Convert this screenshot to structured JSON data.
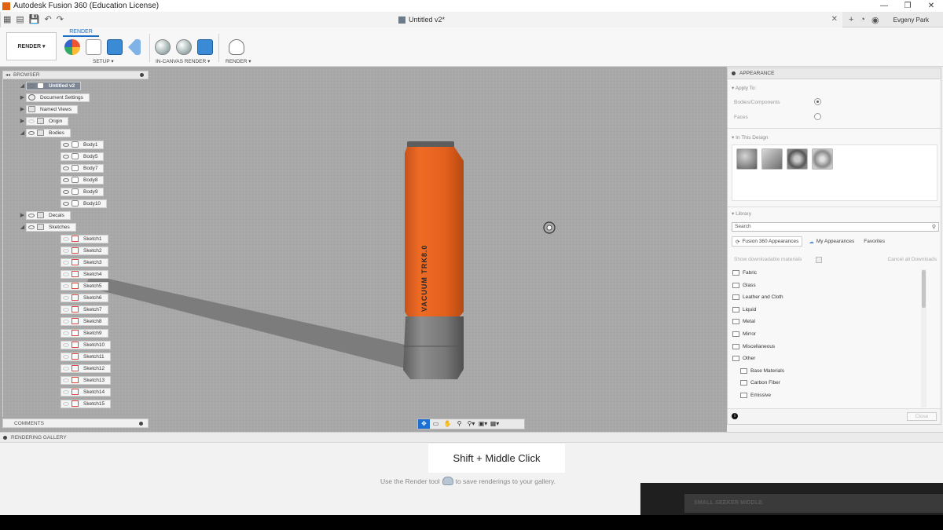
{
  "window": {
    "title": "Autodesk Fusion 360 (Education License)",
    "minimize": "—",
    "restore": "❐",
    "close": "✕"
  },
  "tabs": {
    "document_title": "Untitled v2*",
    "tab_close": "✕",
    "user": "Evgeny Park"
  },
  "toolbar": {
    "workspace": "RENDER ▾",
    "active_tab": "RENDER",
    "groups": {
      "setup": "SETUP ▾",
      "in_canvas": "IN-CANVAS RENDER ▾",
      "render": "RENDER ▾"
    }
  },
  "browser": {
    "title": "BROWSER",
    "root": "Untitled v2",
    "items": [
      {
        "label": "Document Settings"
      },
      {
        "label": "Named Views"
      },
      {
        "label": "Origin"
      },
      {
        "label": "Bodies"
      },
      {
        "label": "Decals"
      },
      {
        "label": "Sketches"
      }
    ],
    "bodies": [
      "Body1",
      "Body5",
      "Body7",
      "Body8",
      "Body9",
      "Body10"
    ],
    "sketches": [
      "Sketch1",
      "Sketch2",
      "Sketch3",
      "Sketch4",
      "Sketch5",
      "Sketch6",
      "Sketch7",
      "Sketch8",
      "Sketch9",
      "Sketch10",
      "Sketch11",
      "Sketch12",
      "Sketch13",
      "Sketch14",
      "Sketch15"
    ]
  },
  "comments": {
    "title": "COMMENTS"
  },
  "viewport": {
    "model_text": "VACUUM TRK8.0",
    "body_color": "#e8651e"
  },
  "appearance": {
    "title": "APPEARANCE",
    "apply_to": "Apply To:",
    "bodies_components": "Bodies/Components",
    "faces": "Faces",
    "apply_selected": "Bodies/Components",
    "in_this_design": "In This Design",
    "library": "Library",
    "search_placeholder": "Search",
    "tabs": [
      "Fusion 360 Appearances",
      "My Appearances",
      "Favorites"
    ],
    "show_downloadable": "Show downloadable materials",
    "cancel_downloads": "Cancel all Downloads",
    "categories": [
      "Fabric",
      "Glass",
      "Leather and Cloth",
      "Liquid",
      "Metal",
      "Mirror",
      "Miscellaneous",
      "Other"
    ],
    "subcategories": [
      "Base Materials",
      "Carbon Fiber",
      "Emissive"
    ],
    "close": "Close"
  },
  "gallery": {
    "title": "RENDERING GALLERY",
    "shortcut": "Shift + Middle Click",
    "hint_before": "Use the Render tool",
    "hint_after": "to save renderings to your gallery.",
    "video_caption": "SMALL SEEKER MIDDLE"
  }
}
